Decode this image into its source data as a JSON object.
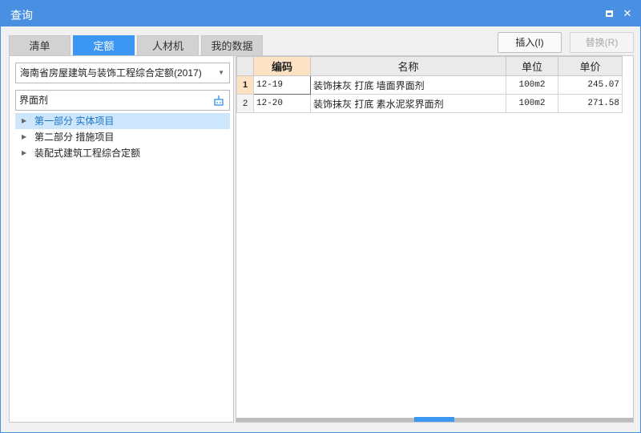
{
  "window": {
    "title": "查询"
  },
  "tabs": [
    {
      "label": "清单",
      "active": false
    },
    {
      "label": "定额",
      "active": true
    },
    {
      "label": "人材机",
      "active": false
    },
    {
      "label": "我的数据",
      "active": false
    }
  ],
  "actions": {
    "insert_label": "插入(I)",
    "replace_label": "替换(R)",
    "replace_enabled": false
  },
  "left": {
    "library_select": {
      "value": "海南省房屋建筑与装饰工程综合定额(2017)"
    },
    "search": {
      "value": "界面剂"
    },
    "tree": [
      {
        "label": "第一部分 实体项目",
        "selected": true
      },
      {
        "label": "第二部分 措施项目",
        "selected": false
      },
      {
        "label": "装配式建筑工程综合定额",
        "selected": false
      }
    ]
  },
  "grid": {
    "columns": [
      "编码",
      "名称",
      "单位",
      "单价"
    ],
    "rows": [
      {
        "num": "1",
        "code": "12-19",
        "name": "装饰抹灰 打底 墙面界面剂",
        "unit": "100m2",
        "price": "245.07"
      },
      {
        "num": "2",
        "code": "12-20",
        "name": "装饰抹灰 打底 素水泥浆界面剂",
        "unit": "100m2",
        "price": "271.58"
      }
    ],
    "current_row": 0
  },
  "colors": {
    "titlebar": "#4a90e2",
    "active_tab": "#3c97f2",
    "selected_tree": "#cde6fb",
    "header_highlight": "#fde3c3"
  }
}
